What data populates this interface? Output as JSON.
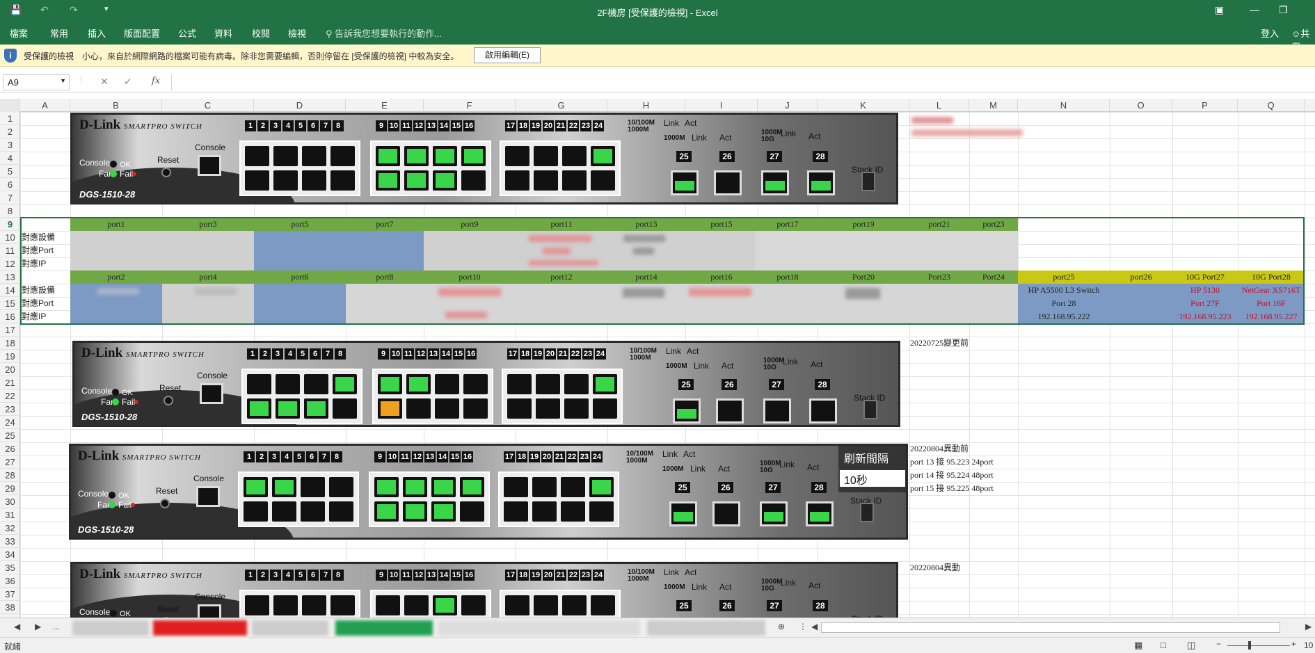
{
  "window": {
    "title": "2F機房 [受保護的檢視] - Excel",
    "undo_icon": "undo-icon",
    "redo_icon": "redo-icon",
    "save_icon": "save-icon"
  },
  "ribbon": {
    "tabs": [
      "檔案",
      "常用",
      "插入",
      "版面配置",
      "公式",
      "資料",
      "校閱",
      "檢視"
    ],
    "tell_me": "告訴我您想要執行的動作...",
    "signin": "登入",
    "share": "共用"
  },
  "protected": {
    "title": "受保護的檢視",
    "message": "小心，來自於網際網路的檔案可能有病毒。除非您需要編輯，否則停留在 [受保護的檢視] 中較為安全。",
    "enable_button": "啟用編輯(E)"
  },
  "formula_bar": {
    "name_box": "A9",
    "fx": "fx",
    "value": ""
  },
  "columns": [
    "A",
    "B",
    "C",
    "D",
    "E",
    "F",
    "G",
    "H",
    "I",
    "J",
    "K",
    "L",
    "M",
    "N",
    "O",
    "P",
    "Q"
  ],
  "rows": [
    "1",
    "2",
    "3",
    "4",
    "5",
    "6",
    "7",
    "8",
    "9",
    "10",
    "11",
    "12",
    "13",
    "14",
    "15",
    "16",
    "17",
    "18",
    "19",
    "20",
    "21",
    "22",
    "23",
    "24",
    "25",
    "26",
    "27",
    "28",
    "29",
    "30",
    "31",
    "32",
    "33",
    "34",
    "35",
    "36",
    "37",
    "38"
  ],
  "odd_ports": [
    "port1",
    "port3",
    "port5",
    "port7",
    "port9",
    "port11",
    "port13",
    "port15",
    "port17",
    "port19",
    "port21",
    "port23"
  ],
  "even_ports": [
    "port2",
    "port4",
    "port6",
    "port8",
    "port10",
    "port12",
    "port14",
    "port16",
    "port18",
    "Port20",
    "Port23",
    "Port24"
  ],
  "uplink_headers": [
    "port25",
    "port26",
    "10G Port27",
    "10G Port28"
  ],
  "row_labels": {
    "device": "對應設備",
    "port": "對應Port",
    "ip": "對應IP"
  },
  "uplinks": {
    "n14": "HP A5500 L3 Switch",
    "n15": "Port 28",
    "n16": "192.168.95.222",
    "p14": "HP 5130",
    "p15": "Port 27F",
    "p16": "192.168.95.223",
    "q14": "NetGear XS716T",
    "q15": "Port 16F",
    "q16": "192.168.95.227"
  },
  "notes": {
    "n18": "20220725變更前",
    "n26": "20220804異動前",
    "n27": "port 13 接 95.223 24port",
    "n28": "port 14 接 95.224 48port",
    "n29": "port 15 接 95.225 48port",
    "n35": "20220804異動"
  },
  "switch": {
    "brand": "D-Link",
    "series": "SMARTPRO SWITCH",
    "model": "DGS-1510-28",
    "console": "Console",
    "ok": "OK",
    "fan": "Fan",
    "fail": "Fail",
    "reset": "Reset",
    "stack_id": "Stack ID",
    "speed1": "10/100M",
    "speed2": "1000M",
    "speed3": "1000M",
    "speed4": "10G",
    "link": "Link",
    "act": "Act",
    "ports": [
      "1",
      "2",
      "3",
      "4",
      "5",
      "6",
      "7",
      "8",
      "9",
      "10",
      "11",
      "12",
      "13",
      "14",
      "15",
      "16",
      "17",
      "18",
      "19",
      "20",
      "21",
      "22",
      "23",
      "24"
    ],
    "sfp_ports": [
      "25",
      "26",
      "27",
      "28"
    ]
  },
  "refresh": {
    "label": "刷新間隔",
    "value": "10秒"
  },
  "statusbar": {
    "ready": "就緒",
    "zoom": "10"
  },
  "colors": {
    "excel_green": "#217346",
    "row_green": "#70a846",
    "uplink_yellow": "#c9c812",
    "uplink_blue": "#7d9ac4",
    "port_green": "#39d64a"
  }
}
